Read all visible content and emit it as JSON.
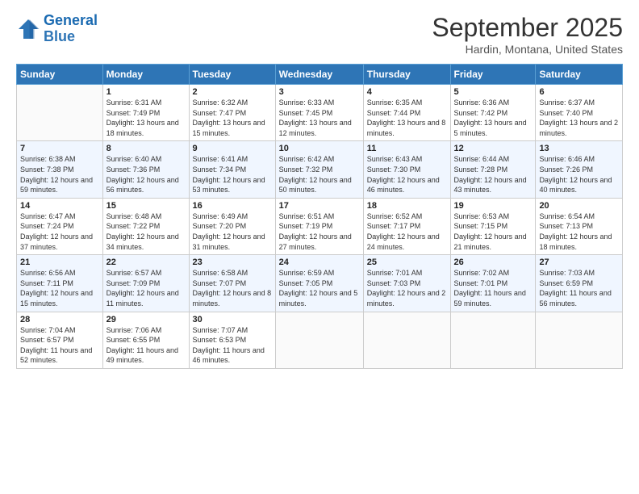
{
  "logo": {
    "line1": "General",
    "line2": "Blue"
  },
  "title": "September 2025",
  "subtitle": "Hardin, Montana, United States",
  "days_of_week": [
    "Sunday",
    "Monday",
    "Tuesday",
    "Wednesday",
    "Thursday",
    "Friday",
    "Saturday"
  ],
  "weeks": [
    [
      {
        "day": "",
        "sunrise": "",
        "sunset": "",
        "daylight": ""
      },
      {
        "day": "1",
        "sunrise": "Sunrise: 6:31 AM",
        "sunset": "Sunset: 7:49 PM",
        "daylight": "Daylight: 13 hours and 18 minutes."
      },
      {
        "day": "2",
        "sunrise": "Sunrise: 6:32 AM",
        "sunset": "Sunset: 7:47 PM",
        "daylight": "Daylight: 13 hours and 15 minutes."
      },
      {
        "day": "3",
        "sunrise": "Sunrise: 6:33 AM",
        "sunset": "Sunset: 7:45 PM",
        "daylight": "Daylight: 13 hours and 12 minutes."
      },
      {
        "day": "4",
        "sunrise": "Sunrise: 6:35 AM",
        "sunset": "Sunset: 7:44 PM",
        "daylight": "Daylight: 13 hours and 8 minutes."
      },
      {
        "day": "5",
        "sunrise": "Sunrise: 6:36 AM",
        "sunset": "Sunset: 7:42 PM",
        "daylight": "Daylight: 13 hours and 5 minutes."
      },
      {
        "day": "6",
        "sunrise": "Sunrise: 6:37 AM",
        "sunset": "Sunset: 7:40 PM",
        "daylight": "Daylight: 13 hours and 2 minutes."
      }
    ],
    [
      {
        "day": "7",
        "sunrise": "Sunrise: 6:38 AM",
        "sunset": "Sunset: 7:38 PM",
        "daylight": "Daylight: 12 hours and 59 minutes."
      },
      {
        "day": "8",
        "sunrise": "Sunrise: 6:40 AM",
        "sunset": "Sunset: 7:36 PM",
        "daylight": "Daylight: 12 hours and 56 minutes."
      },
      {
        "day": "9",
        "sunrise": "Sunrise: 6:41 AM",
        "sunset": "Sunset: 7:34 PM",
        "daylight": "Daylight: 12 hours and 53 minutes."
      },
      {
        "day": "10",
        "sunrise": "Sunrise: 6:42 AM",
        "sunset": "Sunset: 7:32 PM",
        "daylight": "Daylight: 12 hours and 50 minutes."
      },
      {
        "day": "11",
        "sunrise": "Sunrise: 6:43 AM",
        "sunset": "Sunset: 7:30 PM",
        "daylight": "Daylight: 12 hours and 46 minutes."
      },
      {
        "day": "12",
        "sunrise": "Sunrise: 6:44 AM",
        "sunset": "Sunset: 7:28 PM",
        "daylight": "Daylight: 12 hours and 43 minutes."
      },
      {
        "day": "13",
        "sunrise": "Sunrise: 6:46 AM",
        "sunset": "Sunset: 7:26 PM",
        "daylight": "Daylight: 12 hours and 40 minutes."
      }
    ],
    [
      {
        "day": "14",
        "sunrise": "Sunrise: 6:47 AM",
        "sunset": "Sunset: 7:24 PM",
        "daylight": "Daylight: 12 hours and 37 minutes."
      },
      {
        "day": "15",
        "sunrise": "Sunrise: 6:48 AM",
        "sunset": "Sunset: 7:22 PM",
        "daylight": "Daylight: 12 hours and 34 minutes."
      },
      {
        "day": "16",
        "sunrise": "Sunrise: 6:49 AM",
        "sunset": "Sunset: 7:20 PM",
        "daylight": "Daylight: 12 hours and 31 minutes."
      },
      {
        "day": "17",
        "sunrise": "Sunrise: 6:51 AM",
        "sunset": "Sunset: 7:19 PM",
        "daylight": "Daylight: 12 hours and 27 minutes."
      },
      {
        "day": "18",
        "sunrise": "Sunrise: 6:52 AM",
        "sunset": "Sunset: 7:17 PM",
        "daylight": "Daylight: 12 hours and 24 minutes."
      },
      {
        "day": "19",
        "sunrise": "Sunrise: 6:53 AM",
        "sunset": "Sunset: 7:15 PM",
        "daylight": "Daylight: 12 hours and 21 minutes."
      },
      {
        "day": "20",
        "sunrise": "Sunrise: 6:54 AM",
        "sunset": "Sunset: 7:13 PM",
        "daylight": "Daylight: 12 hours and 18 minutes."
      }
    ],
    [
      {
        "day": "21",
        "sunrise": "Sunrise: 6:56 AM",
        "sunset": "Sunset: 7:11 PM",
        "daylight": "Daylight: 12 hours and 15 minutes."
      },
      {
        "day": "22",
        "sunrise": "Sunrise: 6:57 AM",
        "sunset": "Sunset: 7:09 PM",
        "daylight": "Daylight: 12 hours and 11 minutes."
      },
      {
        "day": "23",
        "sunrise": "Sunrise: 6:58 AM",
        "sunset": "Sunset: 7:07 PM",
        "daylight": "Daylight: 12 hours and 8 minutes."
      },
      {
        "day": "24",
        "sunrise": "Sunrise: 6:59 AM",
        "sunset": "Sunset: 7:05 PM",
        "daylight": "Daylight: 12 hours and 5 minutes."
      },
      {
        "day": "25",
        "sunrise": "Sunrise: 7:01 AM",
        "sunset": "Sunset: 7:03 PM",
        "daylight": "Daylight: 12 hours and 2 minutes."
      },
      {
        "day": "26",
        "sunrise": "Sunrise: 7:02 AM",
        "sunset": "Sunset: 7:01 PM",
        "daylight": "Daylight: 11 hours and 59 minutes."
      },
      {
        "day": "27",
        "sunrise": "Sunrise: 7:03 AM",
        "sunset": "Sunset: 6:59 PM",
        "daylight": "Daylight: 11 hours and 56 minutes."
      }
    ],
    [
      {
        "day": "28",
        "sunrise": "Sunrise: 7:04 AM",
        "sunset": "Sunset: 6:57 PM",
        "daylight": "Daylight: 11 hours and 52 minutes."
      },
      {
        "day": "29",
        "sunrise": "Sunrise: 7:06 AM",
        "sunset": "Sunset: 6:55 PM",
        "daylight": "Daylight: 11 hours and 49 minutes."
      },
      {
        "day": "30",
        "sunrise": "Sunrise: 7:07 AM",
        "sunset": "Sunset: 6:53 PM",
        "daylight": "Daylight: 11 hours and 46 minutes."
      },
      {
        "day": "",
        "sunrise": "",
        "sunset": "",
        "daylight": ""
      },
      {
        "day": "",
        "sunrise": "",
        "sunset": "",
        "daylight": ""
      },
      {
        "day": "",
        "sunrise": "",
        "sunset": "",
        "daylight": ""
      },
      {
        "day": "",
        "sunrise": "",
        "sunset": "",
        "daylight": ""
      }
    ]
  ]
}
